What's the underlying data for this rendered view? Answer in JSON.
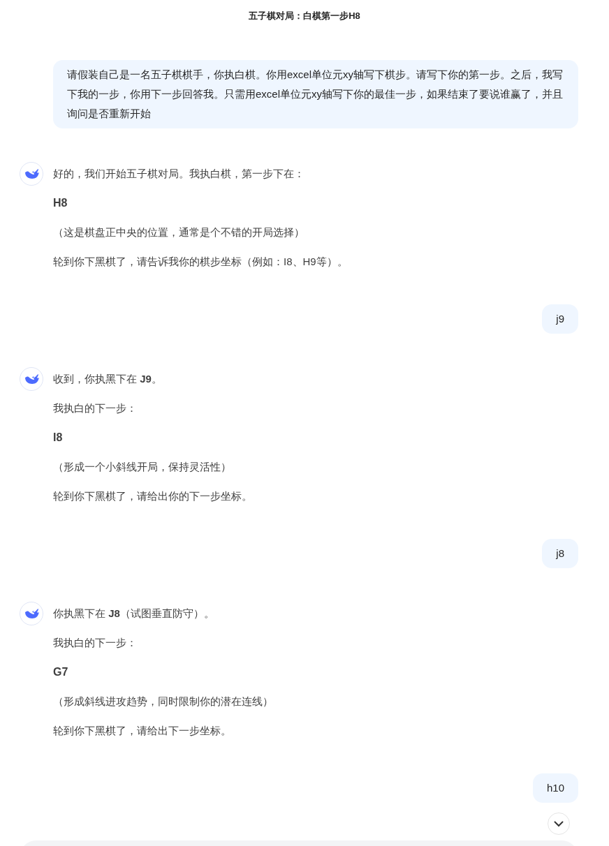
{
  "header": {
    "title": "五子棋对局：白棋第一步H8"
  },
  "messages": [
    {
      "kind": "user",
      "text": "请假装自己是一名五子棋棋手，你执白棋。你用excel单位元xy轴写下棋步。请写下你的第一步。之后，我写下我的一步，你用下一步回答我。只需用excel单位元xy轴写下你的最佳一步，如果结束了要说谁赢了，并且询问是否重新开始"
    },
    {
      "kind": "assistant",
      "paragraphs": [
        {
          "kind": "text",
          "text": "好的，我们开始五子棋对局。我执白棋，第一步下在："
        },
        {
          "kind": "move",
          "text": "H8"
        },
        {
          "kind": "text",
          "text": "（这是棋盘正中央的位置，通常是个不错的开局选择）"
        },
        {
          "kind": "text",
          "text": "轮到你下黑棋了，请告诉我你的棋步坐标（例如：I8、H9等）。"
        }
      ]
    },
    {
      "kind": "user",
      "text": "j9"
    },
    {
      "kind": "assistant",
      "paragraphs": [
        {
          "kind": "text",
          "text": "收到，你执黑下在 **J9**。"
        },
        {
          "kind": "text",
          "text": "我执白的下一步："
        },
        {
          "kind": "move",
          "text": "I8"
        },
        {
          "kind": "text",
          "text": "（形成一个小斜线开局，保持灵活性）"
        },
        {
          "kind": "text",
          "text": "轮到你下黑棋了，请给出你的下一步坐标。"
        }
      ]
    },
    {
      "kind": "user",
      "text": "j8"
    },
    {
      "kind": "assistant",
      "paragraphs": [
        {
          "kind": "text",
          "text": "你执黑下在 **J8**（试图垂直防守）。"
        },
        {
          "kind": "text",
          "text": "我执白的下一步："
        },
        {
          "kind": "move",
          "text": "G7"
        },
        {
          "kind": "text",
          "text": "（形成斜线进攻趋势，同时限制你的潜在连线）"
        },
        {
          "kind": "text",
          "text": "轮到你下黑棋了，请给出下一步坐标。"
        }
      ]
    },
    {
      "kind": "user",
      "text": "h10"
    }
  ]
}
